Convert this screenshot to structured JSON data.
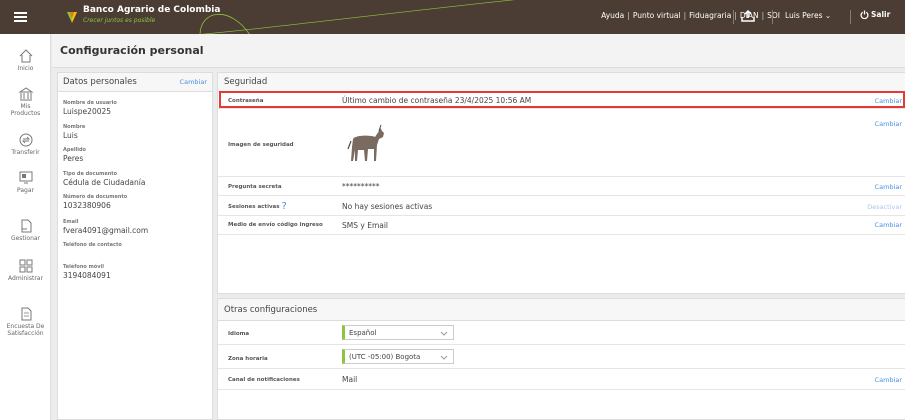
{
  "topbar": {
    "brand_name": "Banco Agrario de Colombia",
    "tagline": "Crecer juntos es posible",
    "links": [
      "Ayuda",
      "Punto virtual",
      "Fiduagraria",
      "DIAN",
      "SOI"
    ],
    "user": "Luis Peres",
    "logout": "Salir"
  },
  "nav": {
    "items": [
      {
        "label1": "Inicio",
        "label2": ""
      },
      {
        "label1": "Mis",
        "label2": "Productos"
      },
      {
        "label1": "Transferir",
        "label2": ""
      },
      {
        "label1": "Pagar",
        "label2": ""
      },
      {
        "label1": "Gestionar",
        "label2": ""
      },
      {
        "label1": "Administrar",
        "label2": ""
      },
      {
        "label1": "Encuesta De",
        "label2": "Satisfacción"
      }
    ]
  },
  "page": {
    "title": "Configuración personal"
  },
  "datos": {
    "title": "Datos personales",
    "change": "Cambiar",
    "fields": [
      {
        "label": "Nombre de usuario",
        "value": "Luispe20025"
      },
      {
        "label": "Nombre",
        "value": "Luis"
      },
      {
        "label": "Apellido",
        "value": "Peres"
      },
      {
        "label": "Tipo de documento",
        "value": "Cédula de Ciudadanía"
      },
      {
        "label": "Número de documento",
        "value": "1032380906"
      },
      {
        "label": "Email",
        "value": "fvera4091@gmail.com"
      },
      {
        "label": "Teléfono de contacto",
        "value": ""
      },
      {
        "label": "Teléfono móvil",
        "value": "3194084091"
      }
    ]
  },
  "seguridad": {
    "title": "Seguridad",
    "rows": [
      {
        "label": "Contraseña",
        "value": "Último cambio de contraseña 23/4/2025 10:56 AM",
        "link": "Cambiar"
      },
      {
        "label": "Imagen de seguridad",
        "value": "",
        "link": "Cambiar"
      },
      {
        "label": "Pregunta secreta",
        "value": "**********",
        "link": "Cambiar"
      },
      {
        "label": "Sesiones activas",
        "value": "No hay sesiones activas",
        "link": "Desactivar",
        "help": "?"
      },
      {
        "label": "Medio de envío código ingreso",
        "value": "SMS y Email",
        "link": "Cambiar"
      }
    ]
  },
  "otras": {
    "title": "Otras configuraciones",
    "idioma_label": "Idioma",
    "idioma_value": "Español",
    "zona_label": "Zona horaria",
    "zona_value": "(UTC -05:00) Bogota",
    "canal_label": "Canal de notificaciones",
    "canal_value": "Mail",
    "canal_link": "Cambiar"
  },
  "colors": {
    "topbar": "#4b3d33",
    "accent_green": "#8cc63f",
    "link_blue": "#4a90e2",
    "highlight_red": "#e53935"
  }
}
